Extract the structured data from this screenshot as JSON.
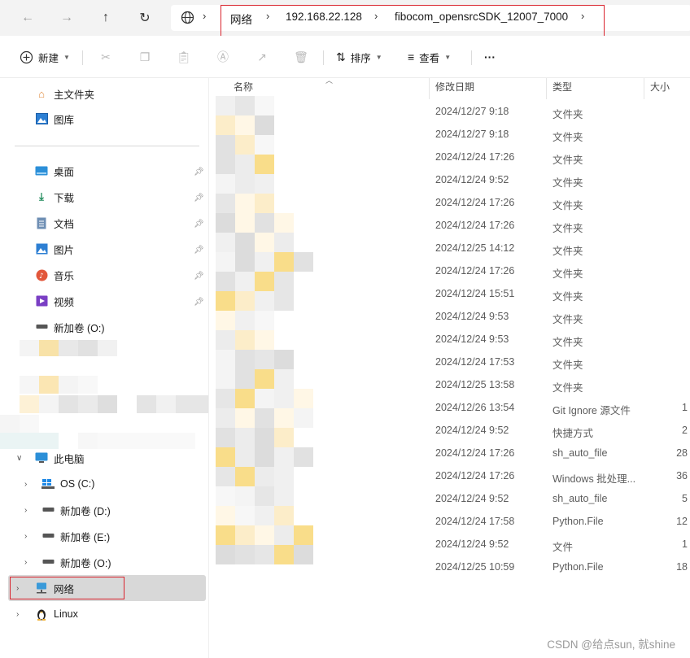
{
  "address_bar": {
    "breadcrumbs": [
      "网络",
      "192.168.22.128",
      "fibocom_opensrcSDK_12007_7000"
    ]
  },
  "toolbar": {
    "new_label": "新建",
    "sort_label": "排序",
    "view_label": "查看",
    "more_label": "···"
  },
  "sidebar": {
    "home": "主文件夹",
    "gallery": "图库",
    "quick_access": [
      {
        "label": "桌面",
        "icon": "desktop-icon"
      },
      {
        "label": "下载",
        "icon": "download-icon"
      },
      {
        "label": "文档",
        "icon": "document-icon"
      },
      {
        "label": "图片",
        "icon": "picture-icon"
      },
      {
        "label": "音乐",
        "icon": "music-icon"
      },
      {
        "label": "视频",
        "icon": "video-icon"
      },
      {
        "label": "新加卷 (O:)",
        "icon": "drive-icon"
      }
    ],
    "this_pc": "此电脑",
    "drives": [
      "OS (C:)",
      "新加卷 (D:)",
      "新加卷 (E:)",
      "新加卷 (O:)"
    ],
    "network": "网络",
    "linux": "Linux"
  },
  "columns": {
    "name": "名称",
    "date": "修改日期",
    "type": "类型",
    "size": "大小"
  },
  "files": [
    {
      "date": "2024/12/27 9:18",
      "type": "文件夹",
      "size": ""
    },
    {
      "date": "2024/12/27 9:18",
      "type": "文件夹",
      "size": ""
    },
    {
      "date": "2024/12/24 17:26",
      "type": "文件夹",
      "size": ""
    },
    {
      "date": "2024/12/24 9:52",
      "type": "文件夹",
      "size": ""
    },
    {
      "date": "2024/12/24 17:26",
      "type": "文件夹",
      "size": ""
    },
    {
      "date": "2024/12/24 17:26",
      "type": "文件夹",
      "size": ""
    },
    {
      "date": "2024/12/25 14:12",
      "type": "文件夹",
      "size": ""
    },
    {
      "date": "2024/12/24 17:26",
      "type": "文件夹",
      "size": ""
    },
    {
      "date": "2024/12/24 15:51",
      "type": "文件夹",
      "size": ""
    },
    {
      "date": "2024/12/24 9:53",
      "type": "文件夹",
      "size": ""
    },
    {
      "date": "2024/12/24 9:53",
      "type": "文件夹",
      "size": ""
    },
    {
      "date": "2024/12/24 17:53",
      "type": "文件夹",
      "size": ""
    },
    {
      "date": "2024/12/25 13:58",
      "type": "文件夹",
      "size": ""
    },
    {
      "date": "2024/12/26 13:54",
      "type": "Git Ignore 源文件",
      "size": "1"
    },
    {
      "date": "2024/12/24 9:52",
      "type": "快捷方式",
      "size": "2"
    },
    {
      "date": "2024/12/24 17:26",
      "type": "sh_auto_file",
      "size": "28"
    },
    {
      "date": "2024/12/24 17:26",
      "type": "Windows 批处理...",
      "size": "36"
    },
    {
      "date": "2024/12/24 9:52",
      "type": "sh_auto_file",
      "size": "5"
    },
    {
      "date": "2024/12/24 17:58",
      "type": "Python.File",
      "size": "12"
    },
    {
      "date": "2024/12/24 9:52",
      "type": "文件",
      "size": "1"
    },
    {
      "date": "2024/12/25 10:59",
      "type": "Python.File",
      "size": "18"
    }
  ],
  "watermark": "CSDN @给点sun, 就shine",
  "colors": {
    "highlight_box": "#d9232d",
    "selected_bg": "#d8d8d8",
    "folder_yellow": "#f8d775"
  }
}
